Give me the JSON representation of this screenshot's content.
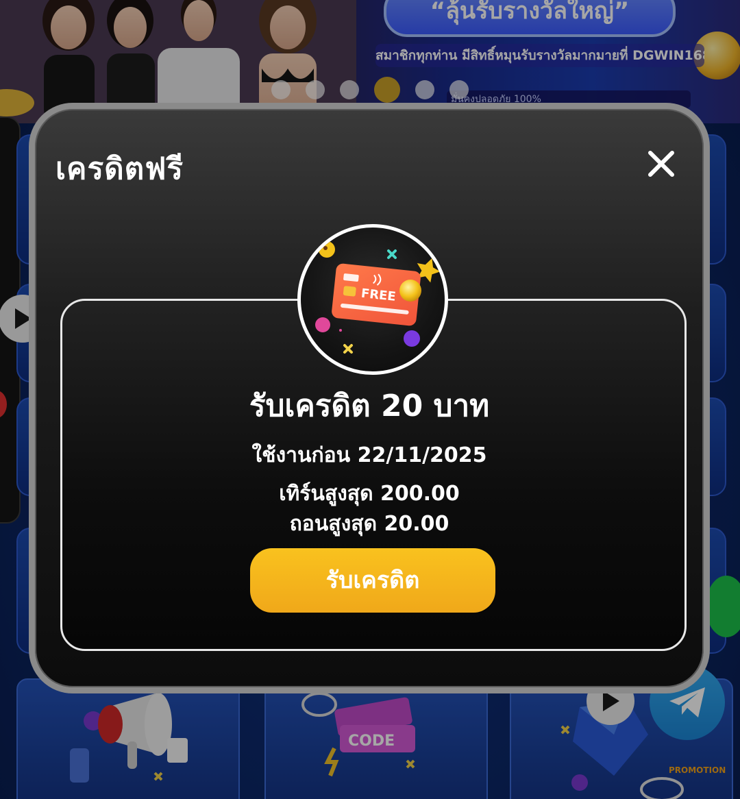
{
  "background": {
    "banner": {
      "pill_text": "“ลุ้นรับรางวัลใหญ่”",
      "subtitle": "สมาชิกทุกท่าน มีสิทธิ์หมุนรับรางวัลมากมายที่ DGWIN168",
      "bottom_text": "มั่นคงปลอดภัย 100%",
      "carousel_dots": 6,
      "active_dot": 4
    },
    "tiles": [
      {
        "label": "CODE"
      },
      {
        "label": "PROMOTION"
      }
    ]
  },
  "modal": {
    "title": "เครดิตฟรี",
    "close_icon": "close-icon",
    "card_icon": {
      "name": "free-credit-card-icon",
      "card_text": "FREE"
    },
    "headline": "รับเครดิต 20 บาท",
    "expiry": "ใช้งานก่อน 22/11/2025",
    "max_turnover": "เทิร์นสูงสุด 200.00",
    "max_withdraw": "ถอนสูงสุด 20.00",
    "claim_button": "รับเครดิต"
  },
  "colors": {
    "accent": "#f5b51c",
    "modal_bg": "#1a1a1a",
    "border": "#8a8a8a"
  }
}
